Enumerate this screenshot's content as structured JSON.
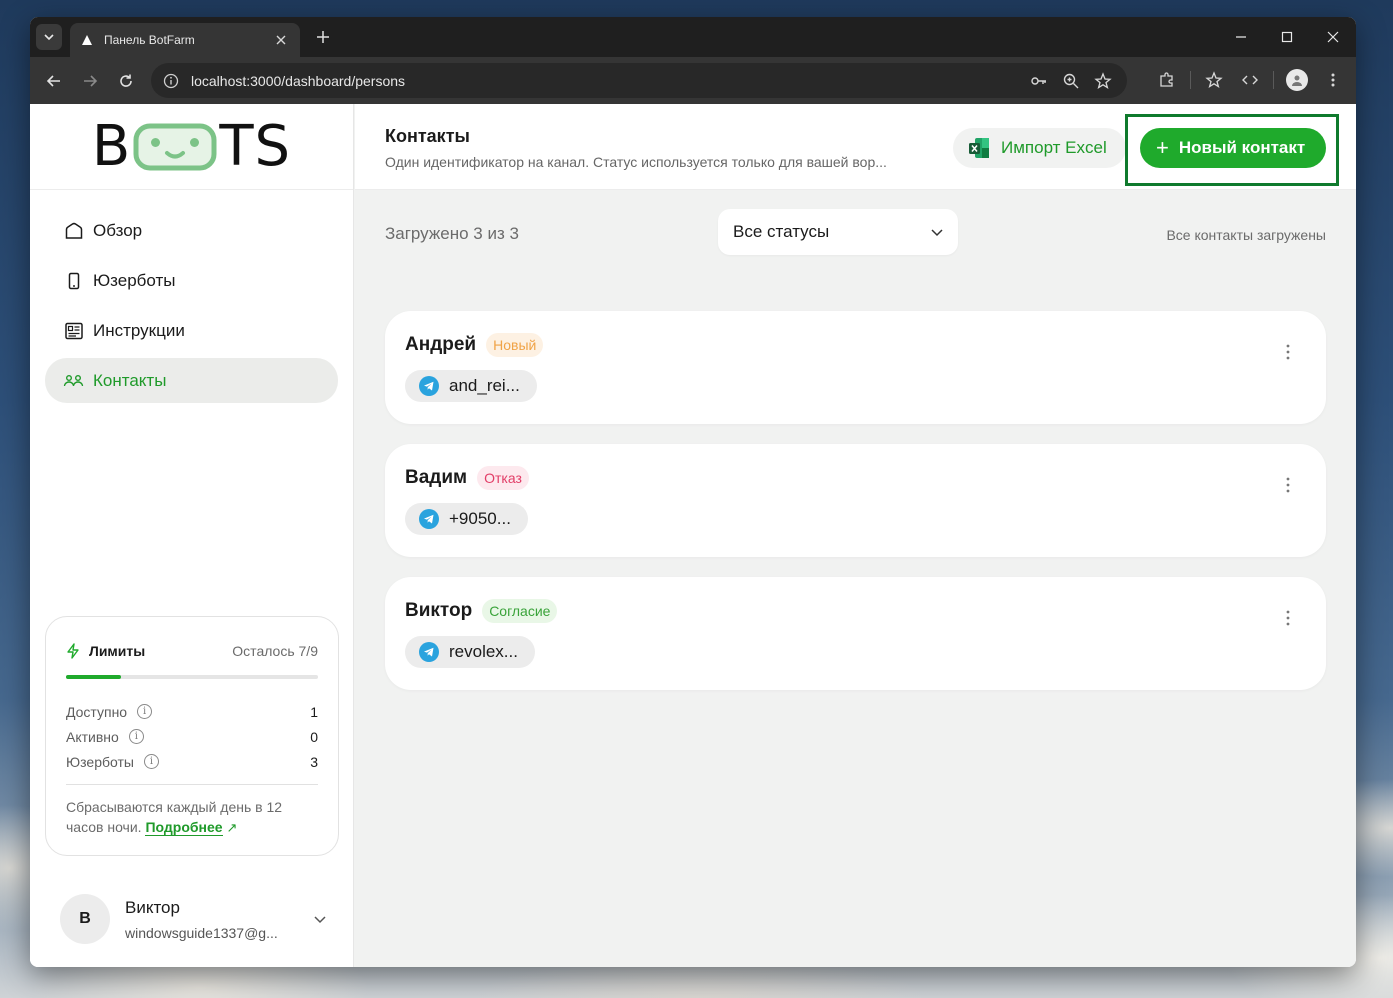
{
  "browser": {
    "tab_title": "Панель BotFarm",
    "url": "localhost:3000/dashboard/persons"
  },
  "sidebar": {
    "logo_left": "B",
    "logo_right": "TS",
    "items": [
      {
        "label": "Обзор",
        "icon": "home-icon"
      },
      {
        "label": "Юзерботы",
        "icon": "phone-icon"
      },
      {
        "label": "Инструкции",
        "icon": "document-icon"
      },
      {
        "label": "Контакты",
        "icon": "people-icon",
        "active": true
      }
    ]
  },
  "limits": {
    "title": "Лимиты",
    "remaining": "Осталось 7/9",
    "progress_fraction": 0.22,
    "rows": [
      {
        "label": "Доступно",
        "value": "1"
      },
      {
        "label": "Активно",
        "value": "0"
      },
      {
        "label": "Юзерботы",
        "value": "3"
      }
    ],
    "info_glyph": "i",
    "note": "Сбрасываются каждый день в 12 часов ночи.",
    "link": "Подробнее",
    "link_arrow": "↗"
  },
  "user": {
    "initial": "В",
    "name": "Виктор",
    "email": "windowsguide1337@g..."
  },
  "header": {
    "title": "Контакты",
    "subtitle": "Один идентификатор на канал. Статус используется только для вашей вор...",
    "import_label": "Импорт Excel",
    "new_label": "Новый контакт",
    "new_plus": "+"
  },
  "filters": {
    "loaded": "Загружено 3 из 3",
    "status_select": "Все статусы",
    "all_loaded": "Все контакты загружены"
  },
  "contacts": [
    {
      "name": "Андрей",
      "status": "Новый",
      "handle": "and_rei..."
    },
    {
      "name": "Вадим",
      "status": "Отказ",
      "handle": "+9050..."
    },
    {
      "name": "Виктор",
      "status": "Согласие",
      "handle": "revolex..."
    }
  ],
  "colors": {
    "accent": "#1faa2c",
    "highlight_outline": "#0f7a2d"
  }
}
